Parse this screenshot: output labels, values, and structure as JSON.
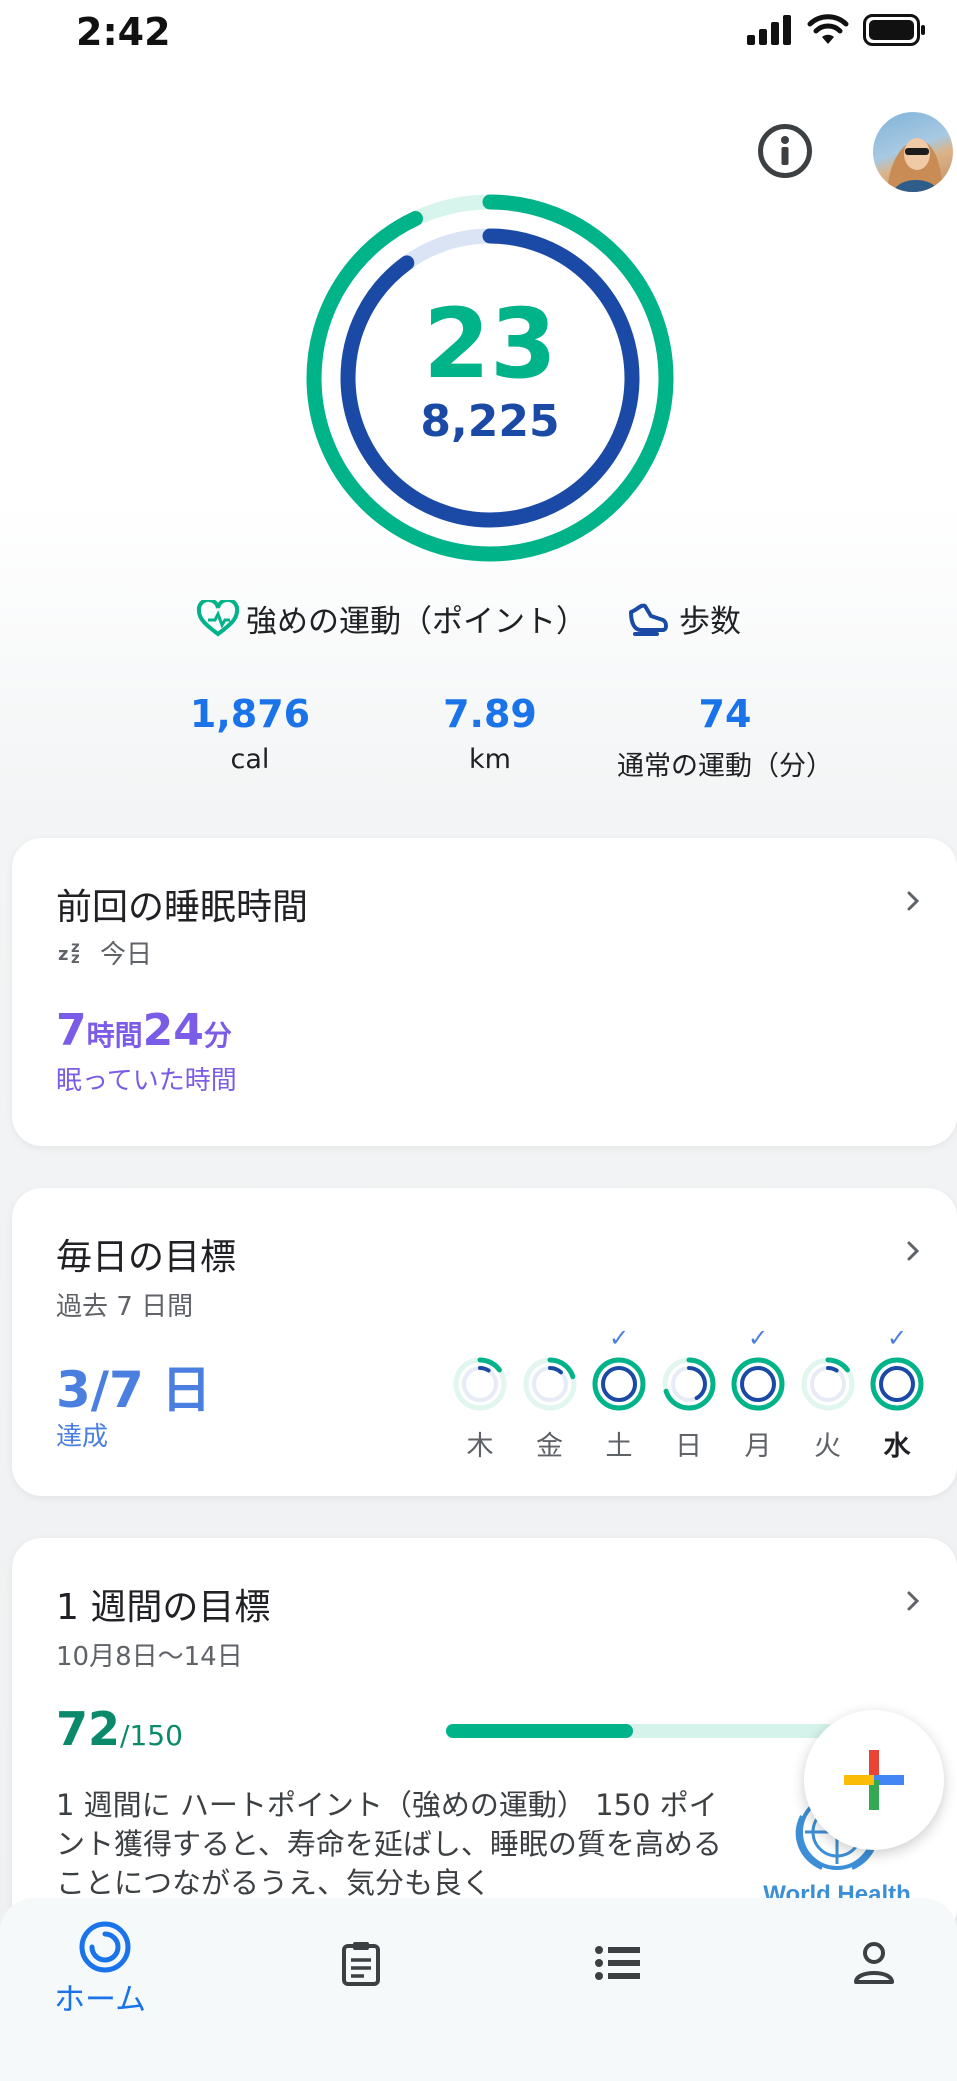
{
  "status_bar": {
    "time": "2:42"
  },
  "colors": {
    "move_green": "#00b388",
    "steps_blue": "#1a4aa6",
    "accent_blue": "#1a73e8",
    "sleep_purple": "#7b5ce6"
  },
  "ring": {
    "heart_points": "23",
    "steps": "8,225",
    "heart_progress": 0.93,
    "steps_progress": 0.9
  },
  "legend": {
    "heart_label": "強めの運動（ポイント）",
    "steps_label": "歩数"
  },
  "stats": [
    {
      "value": "1,876",
      "label": "cal"
    },
    {
      "value": "7.89",
      "label": "km"
    },
    {
      "value": "74",
      "label": "通常の運動（分）"
    }
  ],
  "sleep_card": {
    "title": "前回の睡眠時間",
    "sub": "今日",
    "hours": "7",
    "hours_unit": "時間",
    "minutes": "24",
    "minutes_unit": "分",
    "caption": "眠っていた時間"
  },
  "daily_card": {
    "title": "毎日の目標",
    "sub": "過去 7 日間",
    "achieved": "3/7 日",
    "caption": "達成",
    "days": [
      {
        "label": "木",
        "progress": 0.15,
        "complete": false,
        "bold": false
      },
      {
        "label": "金",
        "progress": 0.2,
        "complete": false,
        "bold": false
      },
      {
        "label": "土",
        "progress": 1.0,
        "complete": true,
        "bold": false
      },
      {
        "label": "日",
        "progress": 0.7,
        "complete": false,
        "bold": false
      },
      {
        "label": "月",
        "progress": 1.0,
        "complete": true,
        "bold": false
      },
      {
        "label": "火",
        "progress": 0.15,
        "complete": false,
        "bold": false
      },
      {
        "label": "水",
        "progress": 1.0,
        "complete": true,
        "bold": true
      }
    ],
    "check_mark": "✓"
  },
  "weekly_card": {
    "title": "1 週間の目標",
    "sub": "10月8日〜14日",
    "current": "72",
    "target": "/150",
    "progress": 0.48,
    "description": "1 週間に ハートポイント（強めの運動） 150 ポイント獲得すると、寿命を延ばし、睡眠の質を高めることにつながるうえ、気分も良く",
    "logo_text": "World Health"
  },
  "bottom_nav": {
    "home_label": "ホーム",
    "items": [
      "home",
      "journal",
      "browse",
      "profile"
    ]
  }
}
